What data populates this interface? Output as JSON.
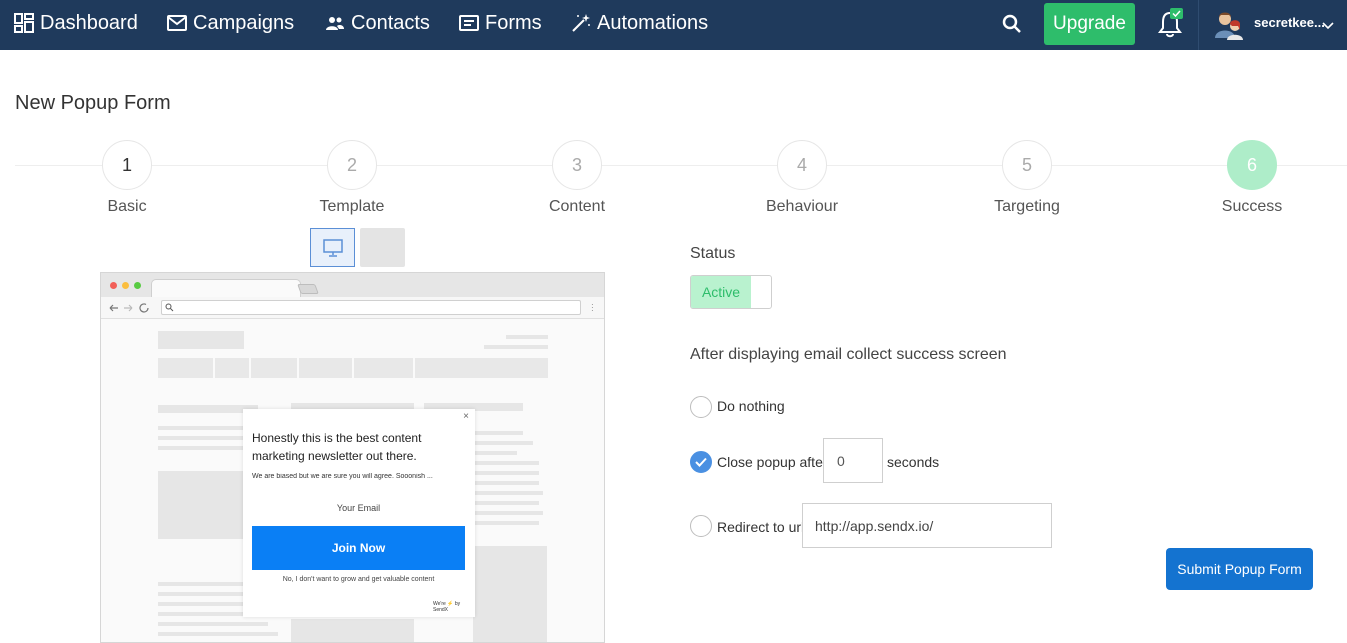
{
  "nav": {
    "items": [
      {
        "label": "Dashboard",
        "icon": "dashboard-icon"
      },
      {
        "label": "Campaigns",
        "icon": "envelope-icon"
      },
      {
        "label": "Contacts",
        "icon": "users-icon"
      },
      {
        "label": "Forms",
        "icon": "form-icon"
      },
      {
        "label": "Automations",
        "icon": "magic-wand-icon"
      }
    ],
    "upgrade_label": "Upgrade",
    "user_name": "secretkee...",
    "colors": {
      "background": "#1f3a5c",
      "upgrade": "#2ebd6b"
    }
  },
  "page": {
    "title": "New Popup Form"
  },
  "stepper": {
    "steps": [
      {
        "number": "1",
        "label": "Basic"
      },
      {
        "number": "2",
        "label": "Template"
      },
      {
        "number": "3",
        "label": "Content"
      },
      {
        "number": "4",
        "label": "Behaviour"
      },
      {
        "number": "5",
        "label": "Targeting"
      },
      {
        "number": "6",
        "label": "Success"
      }
    ],
    "active_step": "6"
  },
  "preview": {
    "device_options": [
      "desktop",
      "mobile"
    ],
    "selected_device": "desktop",
    "popup": {
      "close": "×",
      "heading": "Honestly this is the best content marketing newsletter out there.",
      "subtext": "We are biased but we are sure you will agree. Sooonish ...",
      "email_placeholder": "Your Email",
      "button_label": "Join Now",
      "decline_label": "No, I don't want to grow and get valuable content",
      "credit": "We're ⚡ by SendX"
    }
  },
  "success_settings": {
    "status_label": "Status",
    "status_value": "Active",
    "after_label": "After displaying email collect success screen",
    "options": {
      "do_nothing": "Do nothing",
      "close_popup": "Close popup after",
      "seconds_value": "0",
      "seconds_suffix": "seconds",
      "redirect": "Redirect to url",
      "redirect_url": "http://app.sendx.io/"
    },
    "selected_option": "close_popup",
    "submit_label": "Submit Popup Form"
  }
}
